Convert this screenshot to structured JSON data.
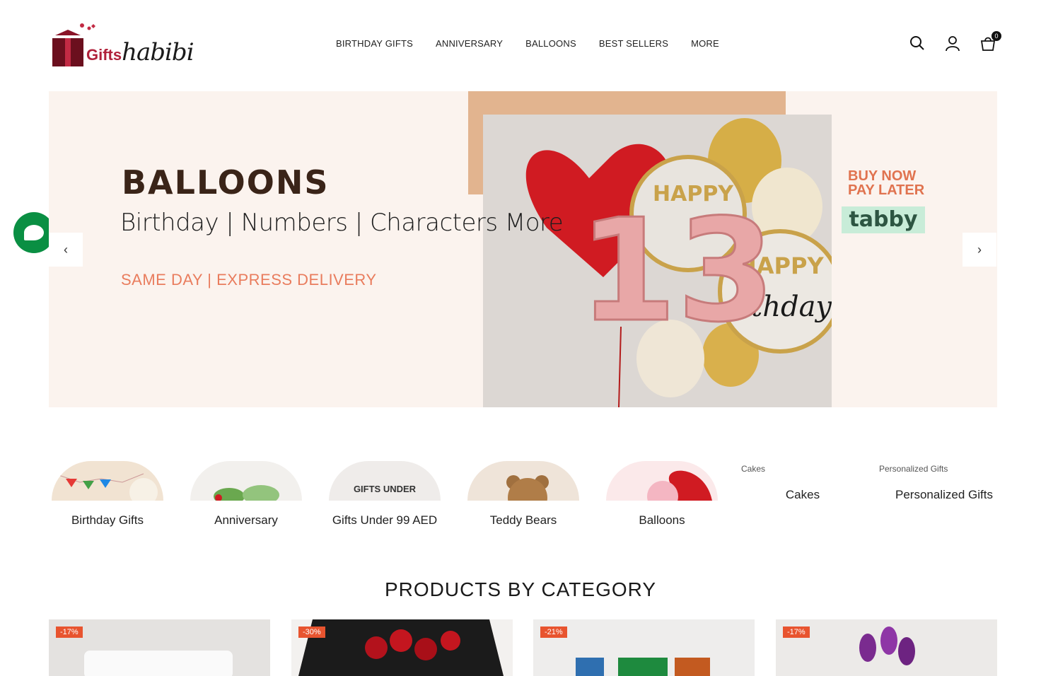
{
  "brand": {
    "name_left": "Gifts",
    "name_right": "habibi"
  },
  "nav": {
    "items": [
      {
        "label": "BIRTHDAY GIFTS"
      },
      {
        "label": "ANNIVERSARY"
      },
      {
        "label": "BALLOONS"
      },
      {
        "label": "BEST SELLERS"
      },
      {
        "label": "MORE"
      }
    ]
  },
  "header": {
    "cart_count": "0"
  },
  "hero": {
    "title": "BALLOONS",
    "subtitle": "Birthday | Numbers | Characters More",
    "delivery": "SAME DAY | EXPRESS DELIVERY",
    "bnpl_line1": "BUY NOW",
    "bnpl_line2": "PAY LATER",
    "bnpl_brand": "tabby",
    "balloon_texts": [
      "HAPPY",
      "HAPPY",
      "rthday",
      "13"
    ],
    "prev_arrow": "‹",
    "next_arrow": "›"
  },
  "categories": [
    {
      "label": "Birthday Gifts"
    },
    {
      "label": "Anniversary"
    },
    {
      "label": "Gifts Under 99 AED",
      "thumb_text": "GIFTS UNDER"
    },
    {
      "label": "Teddy Bears"
    },
    {
      "label": "Balloons"
    }
  ],
  "categories_broken": [
    {
      "alt": "Cakes",
      "label": "Cakes"
    },
    {
      "alt": "Personalized Gifts",
      "label": "Personalized Gifts"
    }
  ],
  "section": {
    "title": "PRODUCTS BY CATEGORY"
  },
  "products": [
    {
      "badge": "-17%"
    },
    {
      "badge": "-30%"
    },
    {
      "badge": "-21%"
    },
    {
      "badge": "-17%"
    }
  ],
  "colors": {
    "accent": "#e97c5d",
    "brand_red": "#b0213a",
    "chat_green": "#0a8f43",
    "badge": "#e8542f"
  }
}
